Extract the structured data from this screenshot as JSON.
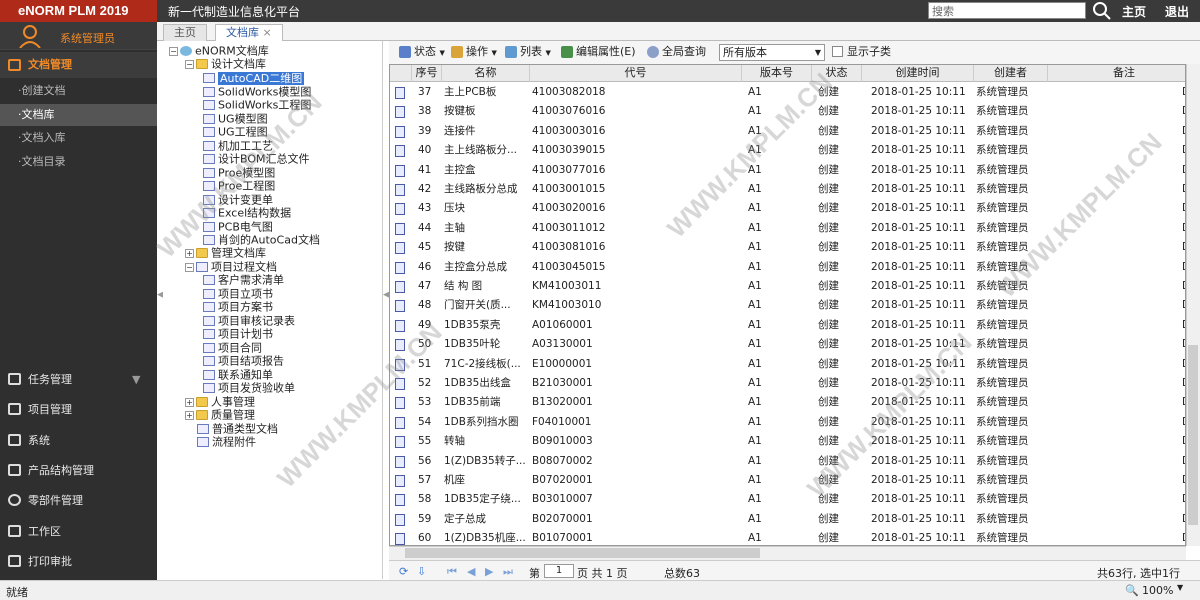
{
  "app": {
    "logo": "eNORM PLM 2019",
    "slogan": "新一代制造业信息化平台",
    "search_placeholder": "搜索",
    "home": "主页",
    "logout": "退出"
  },
  "sidebar": {
    "user": "系统管理员",
    "doc_mgmt": "文档管理",
    "sub": [
      "·创建文档",
      "·文档库",
      "·文档入库",
      "·文档目录"
    ],
    "modules": [
      "任务管理",
      "项目管理",
      "系统",
      "产品结构管理",
      "零部件管理",
      "工作区",
      "打印审批"
    ]
  },
  "tabs": [
    "主页",
    "文档库"
  ],
  "tab_close": "×",
  "tree": {
    "root": "eNORM文档库",
    "design": "设计文档库",
    "design_children": [
      "AutoCAD二维图",
      "SolidWorks模型图",
      "SolidWorks工程图",
      "UG模型图",
      "UG工程图",
      "机加工工艺",
      "设计BOM汇总文件",
      "Proe模型图",
      "Proe工程图",
      "设计变更单",
      "Excel结构数据",
      "PCB电气图",
      "肖剑的AutoCad文档"
    ],
    "mgmt": "管理文档库",
    "project": "项目过程文档",
    "project_children": [
      "客户需求清单",
      "项目立项书",
      "项目方案书",
      "项目审核记录表",
      "项目计划书",
      "项目合同",
      "项目结项报告",
      "联系通知单",
      "项目发货验收单"
    ],
    "hr": "人事管理",
    "quality": "质量管理",
    "normal": "普通类型文档",
    "flow": "流程附件"
  },
  "toolbar": {
    "status": "状态",
    "operate": "操作",
    "list": "列表",
    "edit_attr": "编辑属性(E)",
    "global_query": "全局查询",
    "version": "所有版本",
    "show_sub": "显示子类"
  },
  "grid": {
    "columns": [
      "序号",
      "名称",
      "代号",
      "版本号",
      "状态",
      "创建时间",
      "创建者",
      "备注"
    ],
    "rows": [
      [
        "37",
        "主上PCB板",
        "41003082018",
        "A1",
        "创建",
        "2018-01-25 10:11",
        "系统管理员",
        "",
        "D"
      ],
      [
        "38",
        "按键板",
        "41003076016",
        "A1",
        "创建",
        "2018-01-25 10:11",
        "系统管理员",
        "",
        "D"
      ],
      [
        "39",
        "连接件",
        "41003003016",
        "A1",
        "创建",
        "2018-01-25 10:11",
        "系统管理员",
        "",
        "D"
      ],
      [
        "40",
        "主上线路板分...",
        "41003039015",
        "A1",
        "创建",
        "2018-01-25 10:11",
        "系统管理员",
        "",
        "D"
      ],
      [
        "41",
        "主控盒",
        "41003077016",
        "A1",
        "创建",
        "2018-01-25 10:11",
        "系统管理员",
        "",
        "D"
      ],
      [
        "42",
        "主线路板分总成",
        "41003001015",
        "A1",
        "创建",
        "2018-01-25 10:11",
        "系统管理员",
        "",
        "D"
      ],
      [
        "43",
        "压块",
        "41003020016",
        "A1",
        "创建",
        "2018-01-25 10:11",
        "系统管理员",
        "",
        "D"
      ],
      [
        "44",
        "主轴",
        "41003011012",
        "A1",
        "创建",
        "2018-01-25 10:11",
        "系统管理员",
        "",
        "D"
      ],
      [
        "45",
        "按键",
        "41003081016",
        "A1",
        "创建",
        "2018-01-25 10:11",
        "系统管理员",
        "",
        "D"
      ],
      [
        "46",
        "主控盒分总成",
        "41003045015",
        "A1",
        "创建",
        "2018-01-25 10:11",
        "系统管理员",
        "",
        "D"
      ],
      [
        "47",
        "结 构 图",
        "KM41003011",
        "A1",
        "创建",
        "2018-01-25 10:11",
        "系统管理员",
        "",
        "D"
      ],
      [
        "48",
        "门窗开关(质...",
        "KM41003010",
        "A1",
        "创建",
        "2018-01-25 10:11",
        "系统管理员",
        "",
        "D"
      ],
      [
        "49",
        "1DB35泵壳",
        "A01060001",
        "A1",
        "创建",
        "2018-01-25 10:11",
        "系统管理员",
        "",
        "D"
      ],
      [
        "50",
        "1DB35叶轮",
        "A03130001",
        "A1",
        "创建",
        "2018-01-25 10:11",
        "系统管理员",
        "",
        "D"
      ],
      [
        "51",
        "71C-2接线板(...",
        "E10000001",
        "A1",
        "创建",
        "2018-01-25 10:11",
        "系统管理员",
        "",
        "D"
      ],
      [
        "52",
        "1DB35出线盒",
        "B21030001",
        "A1",
        "创建",
        "2018-01-25 10:11",
        "系统管理员",
        "",
        "D"
      ],
      [
        "53",
        "1DB35前端",
        "B13020001",
        "A1",
        "创建",
        "2018-01-25 10:11",
        "系统管理员",
        "",
        "D"
      ],
      [
        "54",
        "1DB系列挡水圈",
        "F04010001",
        "A1",
        "创建",
        "2018-01-25 10:11",
        "系统管理员",
        "",
        "D"
      ],
      [
        "55",
        "转轴",
        "B09010003",
        "A1",
        "创建",
        "2018-01-25 10:11",
        "系统管理员",
        "",
        "D"
      ],
      [
        "56",
        "1(Z)DB35转子...",
        "B08070002",
        "A1",
        "创建",
        "2018-01-25 10:11",
        "系统管理员",
        "",
        "D"
      ],
      [
        "57",
        "机座",
        "B07020001",
        "A1",
        "创建",
        "2018-01-25 10:11",
        "系统管理员",
        "",
        "D"
      ],
      [
        "58",
        "1DB35定子绕...",
        "B03010007",
        "A1",
        "创建",
        "2018-01-25 10:11",
        "系统管理员",
        "",
        "D"
      ],
      [
        "59",
        "定子总成",
        "B02070001",
        "A1",
        "创建",
        "2018-01-25 10:11",
        "系统管理员",
        "",
        "D"
      ],
      [
        "60",
        "1(Z)DB35机座...",
        "B01070001",
        "A1",
        "创建",
        "2018-01-25 10:11",
        "系统管理员",
        "",
        "D"
      ]
    ]
  },
  "pager": {
    "page_label": "第",
    "page": "1",
    "page_of": "页  共 1 页",
    "total": "总数63",
    "summary": "共63行, 选中1行"
  },
  "status": {
    "left": "就绪",
    "zoom": "100%"
  },
  "watermark": "WWW.KMPLM.CN"
}
